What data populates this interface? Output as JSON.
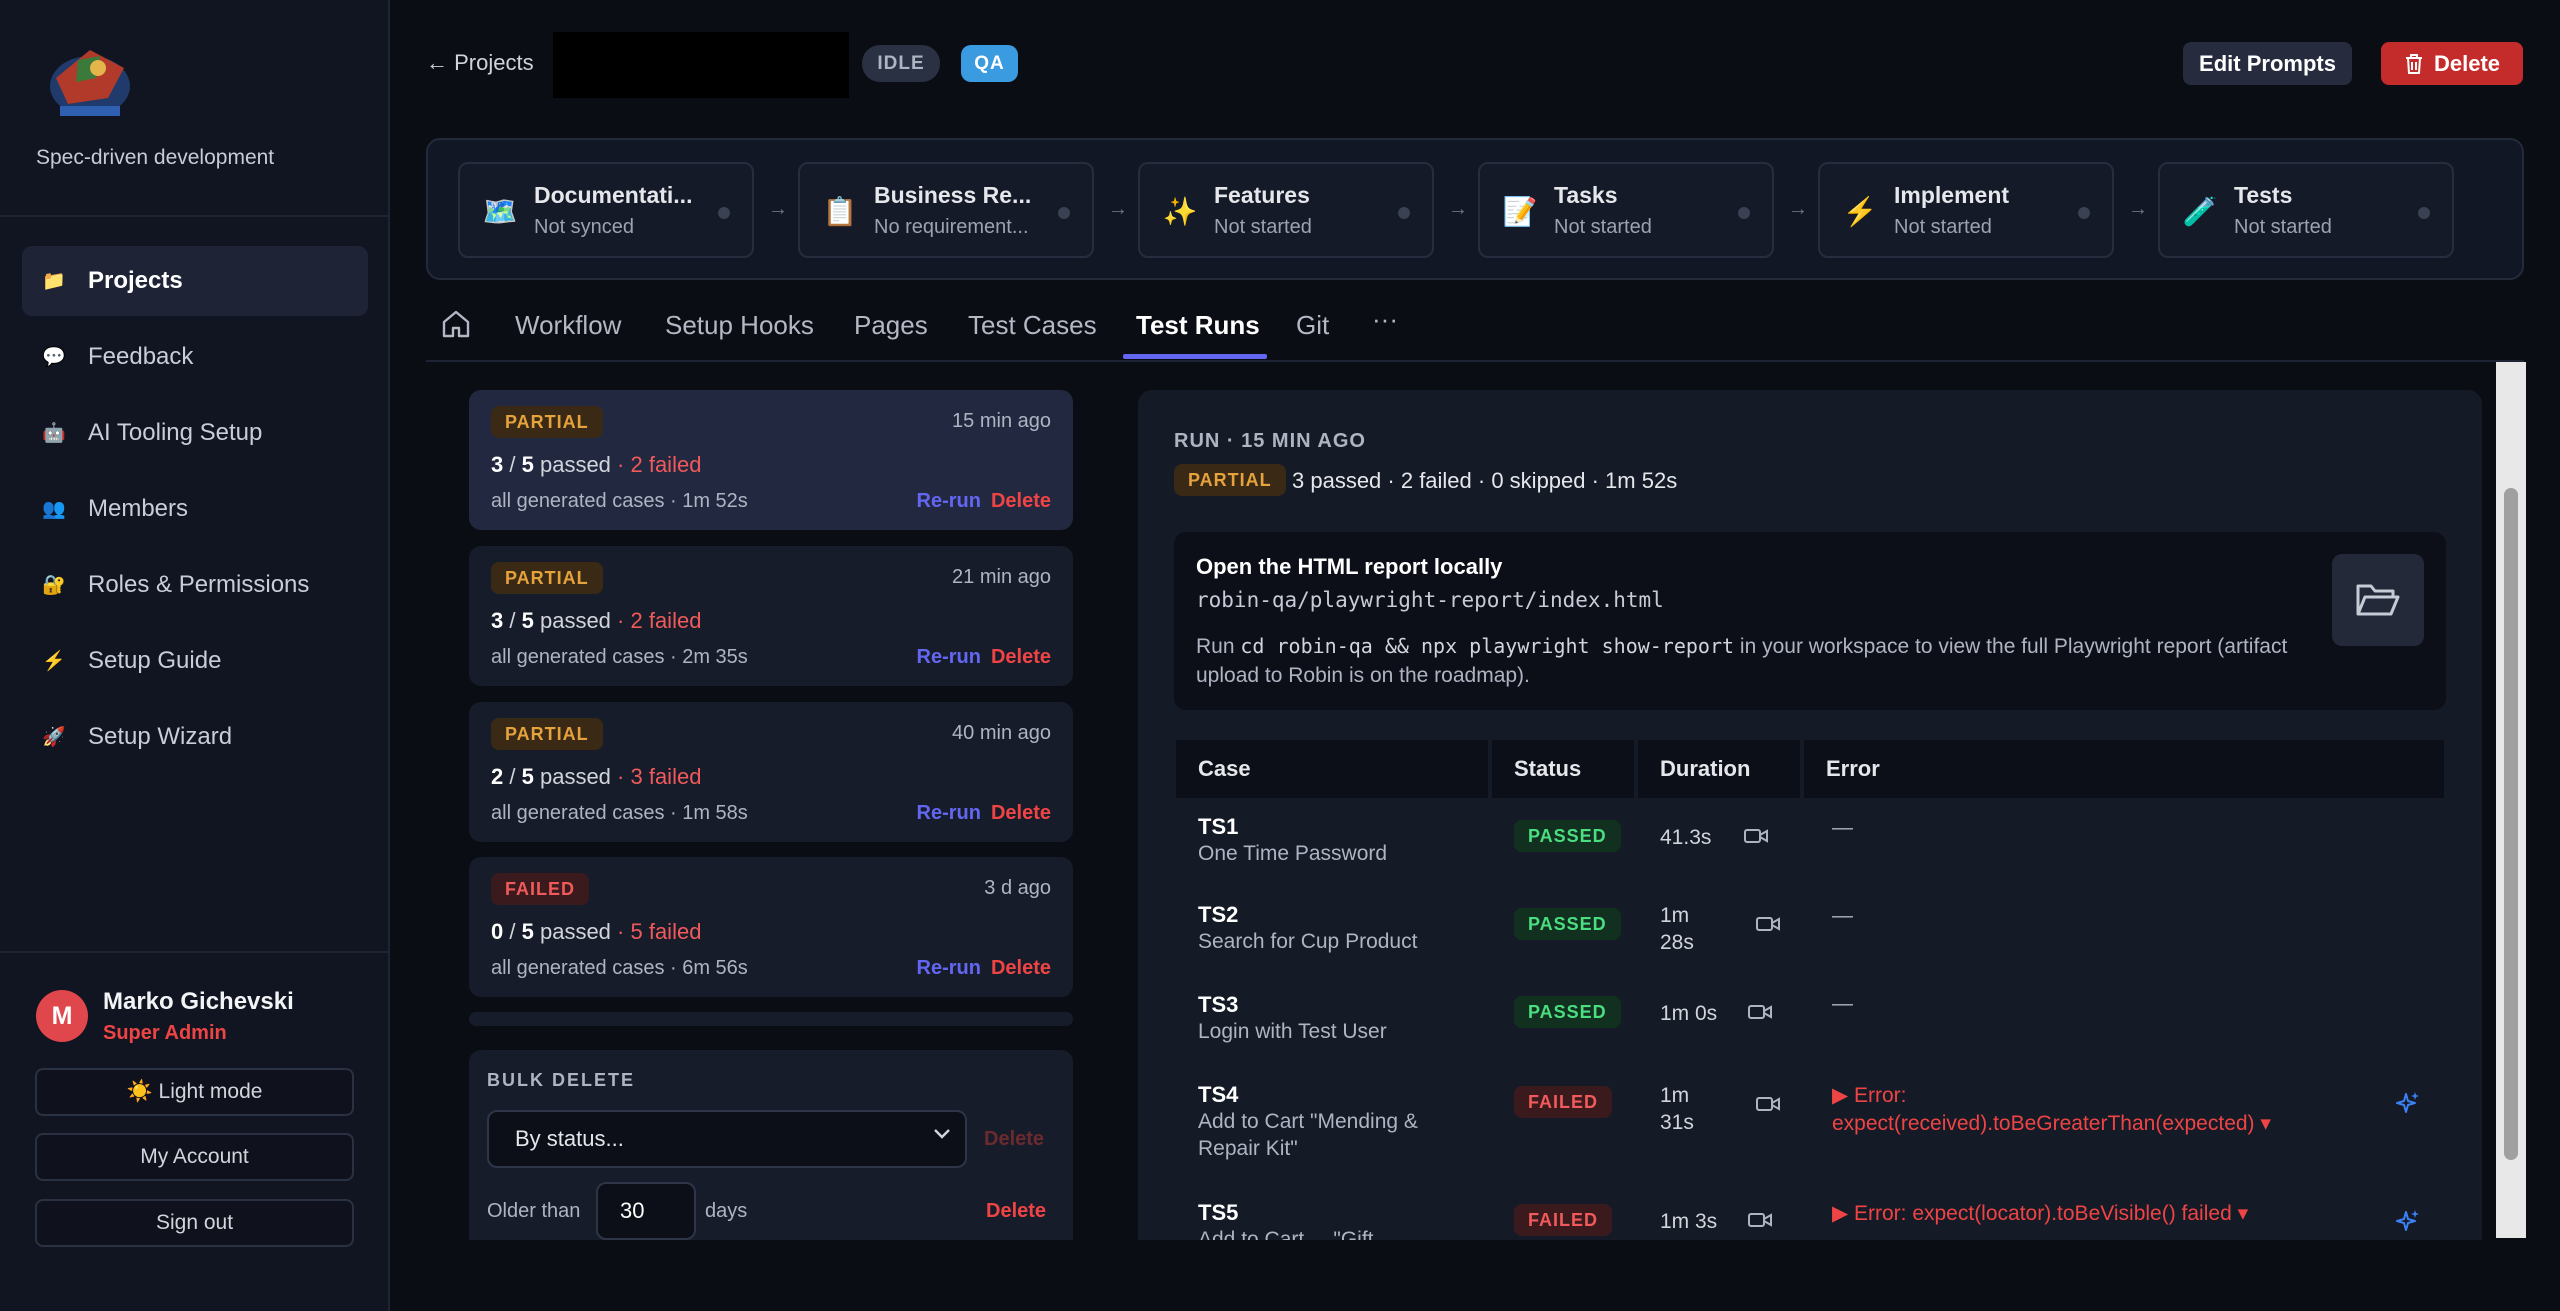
{
  "sidebar": {
    "tagline": "Spec-driven development",
    "nav": [
      {
        "icon": "📁",
        "label": "Projects",
        "active": true
      },
      {
        "icon": "💬",
        "label": "Feedback"
      },
      {
        "icon": "🤖",
        "label": "AI Tooling Setup"
      },
      {
        "icon": "👥",
        "label": "Members"
      },
      {
        "icon": "🔐",
        "label": "Roles & Permissions"
      },
      {
        "icon": "⚡",
        "label": "Setup Guide"
      },
      {
        "icon": "🚀",
        "label": "Setup Wizard"
      }
    ],
    "user": {
      "initial": "M",
      "name": "Marko Gichevski",
      "role": "Super Admin"
    },
    "light_mode": "☀️ Light mode",
    "my_account": "My Account",
    "sign_out": "Sign out"
  },
  "header": {
    "back": "← Projects",
    "status_pill": "IDLE",
    "type_pill": "QA",
    "edit_prompts": "Edit Prompts",
    "delete": "Delete"
  },
  "steps": [
    {
      "icon": "🗺️",
      "title": "Documentati...",
      "sub": "Not synced"
    },
    {
      "icon": "📋",
      "title": "Business Re...",
      "sub": "No requirement..."
    },
    {
      "icon": "✨",
      "title": "Features",
      "sub": "Not started"
    },
    {
      "icon": "📝",
      "title": "Tasks",
      "sub": "Not started"
    },
    {
      "icon": "⚡",
      "title": "Implement",
      "sub": "Not started"
    },
    {
      "icon": "🧪",
      "title": "Tests",
      "sub": "Not started"
    }
  ],
  "tabs": [
    "Workflow",
    "Setup Hooks",
    "Pages",
    "Test Cases",
    "Test Runs",
    "Git",
    "···"
  ],
  "active_tab": "Test Runs",
  "runs": [
    {
      "status": "PARTIAL",
      "time": "15 min ago",
      "passed": "3",
      "total": "5",
      "passed_label": "passed",
      "failed": "· 2 failed",
      "meta": "all generated cases · 1m 52s",
      "rerun": "Re-run",
      "delete": "Delete"
    },
    {
      "status": "PARTIAL",
      "time": "21 min ago",
      "passed": "3",
      "total": "5",
      "passed_label": "passed",
      "failed": "· 2 failed",
      "meta": "all generated cases · 2m 35s",
      "rerun": "Re-run",
      "delete": "Delete"
    },
    {
      "status": "PARTIAL",
      "time": "40 min ago",
      "passed": "2",
      "total": "5",
      "passed_label": "passed",
      "failed": "· 3 failed",
      "meta": "all generated cases · 1m 58s",
      "rerun": "Re-run",
      "delete": "Delete"
    },
    {
      "status": "FAILED",
      "time": "3 d ago",
      "passed": "0",
      "total": "5",
      "passed_label": "passed",
      "failed": "· 5 failed",
      "meta": "all generated cases · 6m 56s",
      "rerun": "Re-run",
      "delete": "Delete"
    }
  ],
  "bulk": {
    "title": "BULK DELETE",
    "select_value": "By status...",
    "delete": "Delete",
    "older_than": "Older than",
    "days_value": "30",
    "days": "days",
    "delete2": "Delete"
  },
  "detail": {
    "heading": "RUN · 15 MIN AGO",
    "status": "PARTIAL",
    "summary": "3 passed · 2 failed · 0 skipped · 1m 52s",
    "report_title": "Open the HTML report locally",
    "report_path": "robin-qa/playwright-report/index.html",
    "report_desc_pre": "Run",
    "report_cmd": "cd robin-qa && npx playwright show-report",
    "report_desc_post": "in your workspace to view the full Playwright report (artifact upload to Robin is on the roadmap).",
    "columns": [
      "Case",
      "Status",
      "Duration",
      "Error"
    ],
    "rows": [
      {
        "id": "TS1",
        "name": "One Time Password",
        "status": "PASSED",
        "duration": "41.3s",
        "error": "—"
      },
      {
        "id": "TS2",
        "name": "Search for Cup Product",
        "status": "PASSED",
        "duration": "1m 28s",
        "error": "—"
      },
      {
        "id": "TS3",
        "name": "Login with Test User",
        "status": "PASSED",
        "duration": "1m 0s",
        "error": "—"
      },
      {
        "id": "TS4",
        "name": "Add to Cart \"Mending & Repair Kit\"",
        "status": "FAILED",
        "duration": "1m 31s",
        "error": "▶ Error: expect(received).toBeGreaterThan(expected) ▾"
      },
      {
        "id": "TS5",
        "name": "Add to Cart ... \"Gift",
        "status": "FAILED",
        "duration": "1m 3s",
        "error": "▶ Error: expect(locator).toBeVisible() failed ▾"
      }
    ]
  }
}
